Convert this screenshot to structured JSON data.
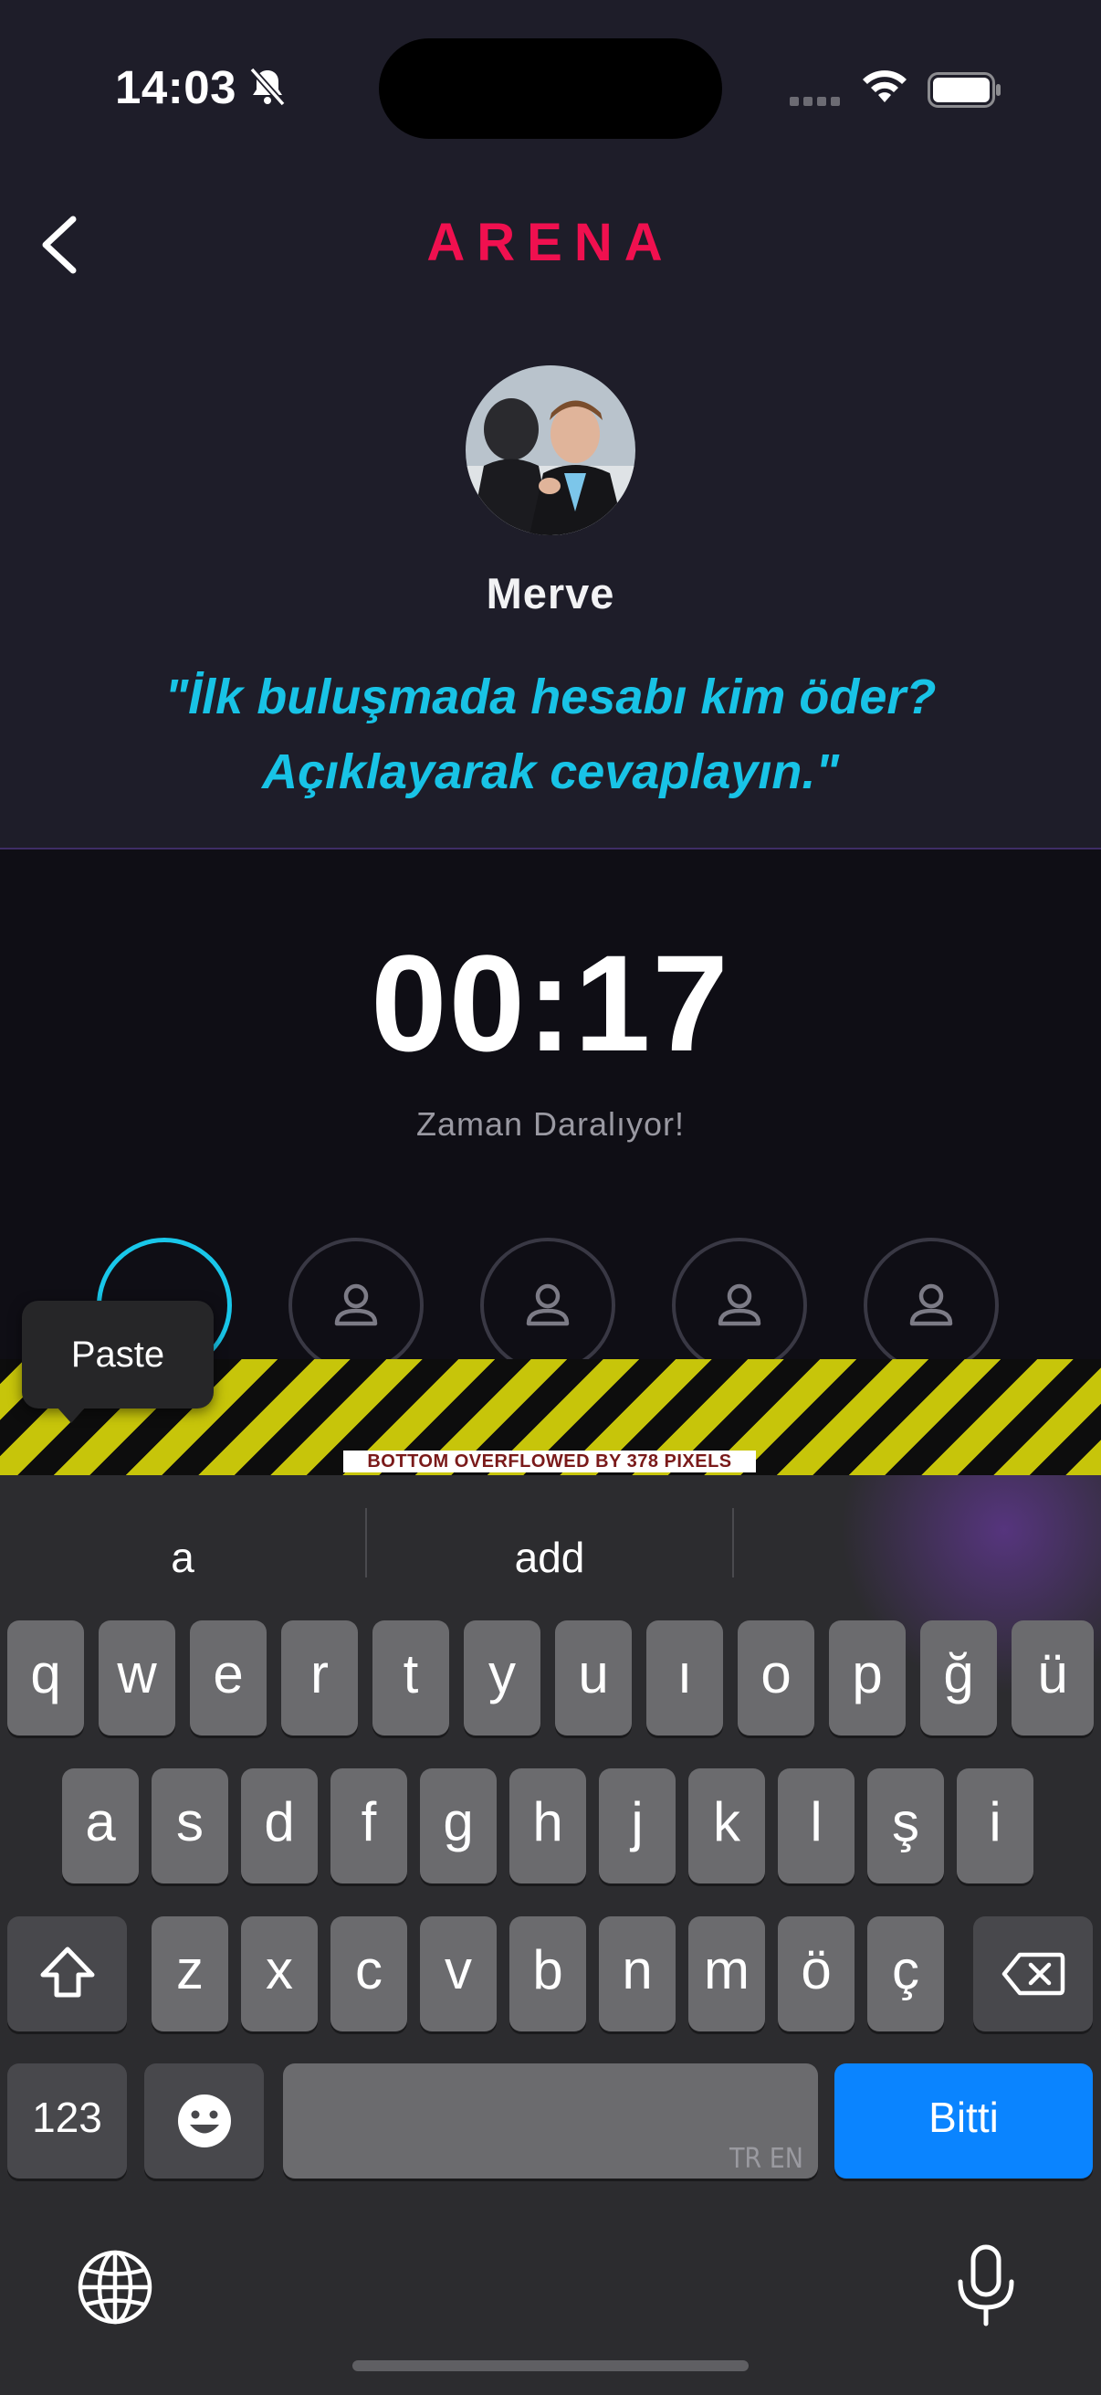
{
  "status_bar": {
    "time": "14:03",
    "icons": [
      "bell-slash-icon",
      "cellular-icon",
      "wifi-icon",
      "battery-icon"
    ]
  },
  "header": {
    "title": "ARENA",
    "back_icon": "chevron-left-icon"
  },
  "profile": {
    "name": "Merve"
  },
  "question": {
    "line1": "\"İlk buluşmada hesabı kim öder?",
    "line2": "Açıklayarak cevaplayın.\""
  },
  "timer": {
    "value": "00:17",
    "subtitle": "Zaman Daralıyor!"
  },
  "participants": {
    "count": 5,
    "active_index": 0
  },
  "debug": {
    "overflow_label": "BOTTOM OVERFLOWED BY 378 PIXELS"
  },
  "context_menu": {
    "paste_label": "Paste"
  },
  "keyboard": {
    "suggestions": [
      "a",
      "add"
    ],
    "row1": [
      "q",
      "w",
      "e",
      "r",
      "t",
      "y",
      "u",
      "ı",
      "o",
      "p",
      "ğ",
      "ü"
    ],
    "row2": [
      "a",
      "s",
      "d",
      "f",
      "g",
      "h",
      "j",
      "k",
      "l",
      "ş",
      "i"
    ],
    "row3": [
      "z",
      "x",
      "c",
      "v",
      "b",
      "n",
      "m",
      "ö",
      "ç"
    ],
    "numbers_label": "123",
    "language_label": "TR EN",
    "done_label": "Bitti"
  },
  "colors": {
    "title": "#f0104f",
    "question": "#18c3e6",
    "active_ring": "#19c7ea",
    "done_key": "#0a84ff"
  }
}
